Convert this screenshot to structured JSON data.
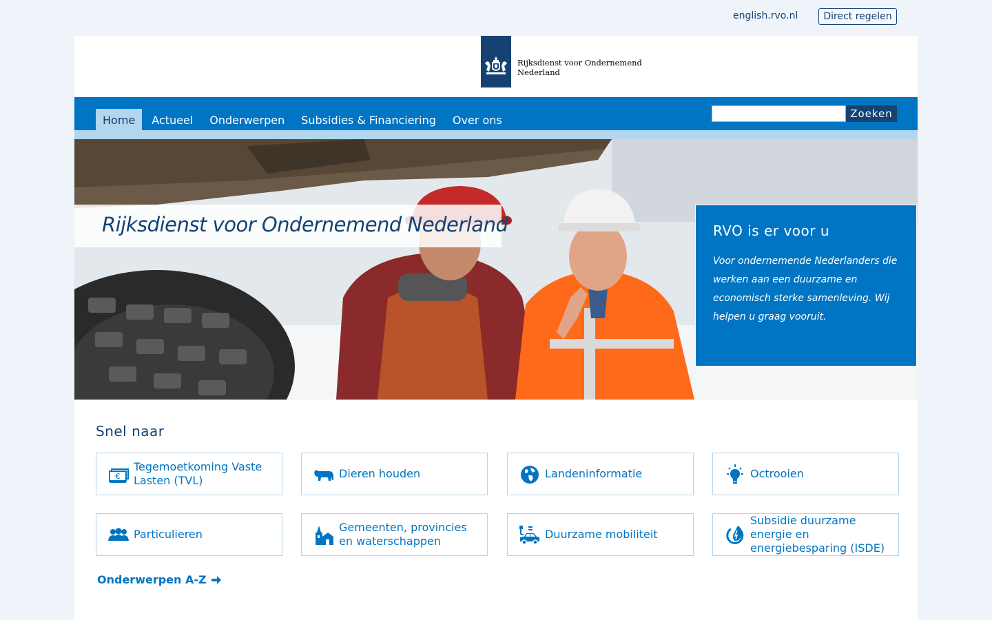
{
  "topbar": {
    "english_link": "english.rvo.nl",
    "direct_button": "Direct regelen"
  },
  "logo": {
    "name_line1": "Rijksdienst voor Ondernemend",
    "name_line2": "Nederland"
  },
  "nav": {
    "items": [
      {
        "label": "Home",
        "active": true
      },
      {
        "label": "Actueel"
      },
      {
        "label": "Onderwerpen"
      },
      {
        "label": "Subsidies & Financiering"
      },
      {
        "label": "Over ons"
      }
    ]
  },
  "search": {
    "placeholder": "",
    "button": "Zoeken"
  },
  "hero": {
    "title": "Rijksdienst voor Ondernemend Nederland",
    "callout_title": "RVO is er voor u",
    "callout_text": "Voor ondernemende Nederlanders die werken aan een duurzame en economisch sterke samenleving. Wij helpen u graag vooruit."
  },
  "quick": {
    "heading": "Snel naar",
    "tiles": [
      {
        "label": "Tegemoetkoming Vaste Lasten (TVL)",
        "icon": "money-icon"
      },
      {
        "label": "Dieren houden",
        "icon": "cow-icon"
      },
      {
        "label": "Landeninformatie",
        "icon": "globe-icon"
      },
      {
        "label": "Octrooien",
        "icon": "lightbulb-icon"
      },
      {
        "label": "Particulieren",
        "icon": "people-icon"
      },
      {
        "label": "Gemeenten, provincies en waterschappen",
        "icon": "municipality-icon"
      },
      {
        "label": "Duurzame mobiliteit",
        "icon": "electric-car-icon"
      },
      {
        "label": "Subsidie duurzame energie en energiebesparing (ISDE)",
        "icon": "energy-icon"
      }
    ]
  },
  "az_link": "Onderwerpen A-Z",
  "colors": {
    "primary_blue": "#0075c3",
    "dark_blue": "#154273",
    "light_blue": "#b2d6ee"
  }
}
